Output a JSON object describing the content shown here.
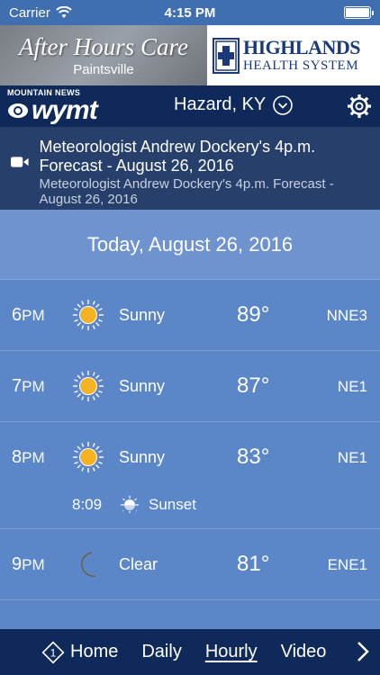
{
  "status_bar": {
    "carrier": "Carrier",
    "time": "4:15 PM",
    "icons": [
      "wifi-icon",
      "battery-icon"
    ]
  },
  "ad": {
    "left_title": "After Hours Care",
    "left_subtitle": "Paintsville",
    "right_line1": "HIGHLANDS",
    "right_line2": "HEALTH SYSTEM"
  },
  "header": {
    "brand_top": "MOUNTAIN NEWS",
    "brand_name": "wymt",
    "location": "Hazard, KY",
    "icons": [
      "chevron-down-icon",
      "gear-icon"
    ]
  },
  "video": {
    "title": "Meteorologist Andrew Dockery's 4p.m. Forecast - August 26, 2016",
    "subtitle": "Meteorologist Andrew Dockery's 4p.m. Forecast - August 26, 2016",
    "icon": "video-camera-icon"
  },
  "date_header": "Today, August 26, 2016",
  "hours": [
    {
      "hour": "6",
      "ampm": "PM",
      "icon": "sun-icon",
      "condition": "Sunny",
      "temp": "89°",
      "wind": "NNE3"
    },
    {
      "hour": "7",
      "ampm": "PM",
      "icon": "sun-icon",
      "condition": "Sunny",
      "temp": "87°",
      "wind": "NE1"
    },
    {
      "hour": "8",
      "ampm": "PM",
      "icon": "sun-icon",
      "condition": "Sunny",
      "temp": "83°",
      "wind": "NE1",
      "sunset_time": "8:09",
      "sunset_label": "Sunset"
    },
    {
      "hour": "9",
      "ampm": "PM",
      "icon": "moon-icon",
      "condition": "Clear",
      "temp": "81°",
      "wind": "ENE1"
    }
  ],
  "nav": {
    "home_badge": "1",
    "home": "Home",
    "daily": "Daily",
    "hourly": "Hourly",
    "video": "Video",
    "active": "Hourly"
  },
  "colors": {
    "background": "#5b86c8",
    "header": "#0f2a5a",
    "video_banner": "#27406b",
    "sun": "#f5b323",
    "moon": "#c9a64e"
  }
}
